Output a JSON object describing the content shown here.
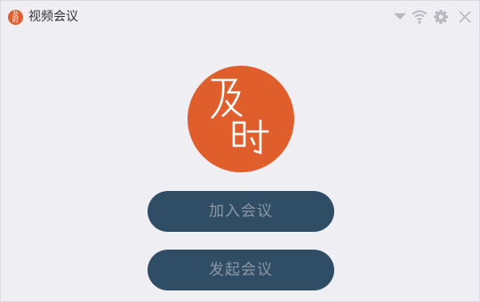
{
  "window": {
    "title": "视频会议",
    "app_icon_text": [
      "及",
      "时"
    ]
  },
  "titlebar_icons": [
    {
      "name": "dropdown-triangle-icon"
    },
    {
      "name": "wifi-icon"
    },
    {
      "name": "gear-icon"
    },
    {
      "name": "close-icon"
    }
  ],
  "logo": {
    "text": "及时",
    "color": "#e05e2c"
  },
  "buttons": {
    "join_label": "加入会议",
    "start_label": "发起会议",
    "color": "#2f4e66"
  }
}
